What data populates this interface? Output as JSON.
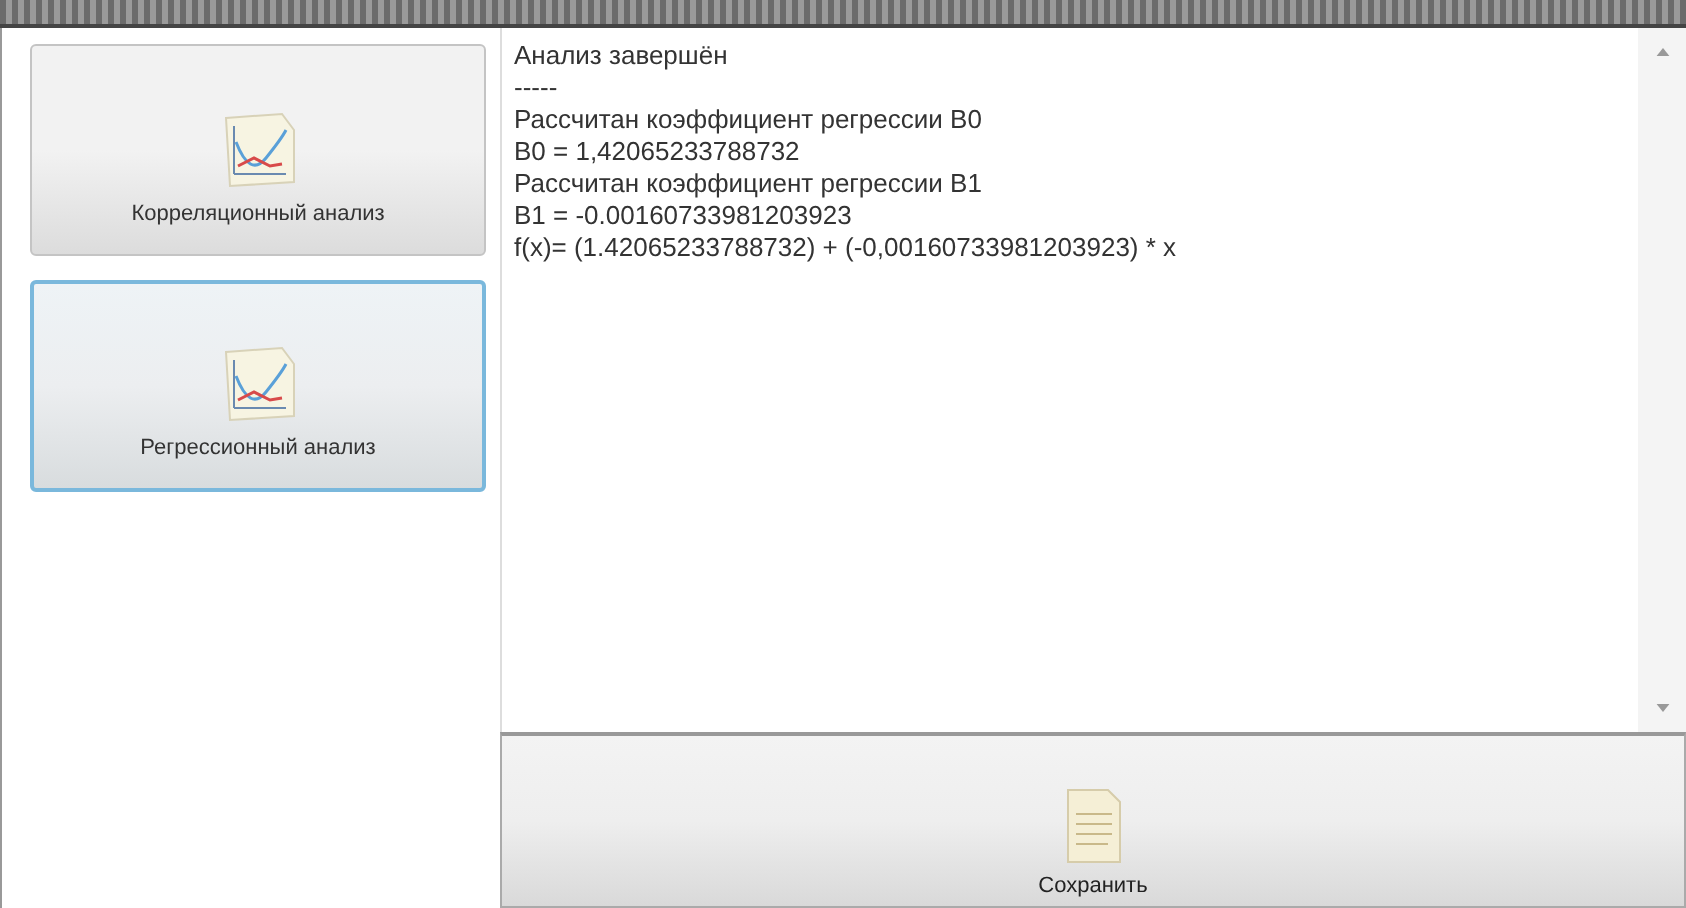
{
  "analysis_buttons": [
    {
      "label": "Корреляционный анализ",
      "selected": false
    },
    {
      "label": "Регрессионный анализ",
      "selected": true
    }
  ],
  "output": {
    "lines": [
      "Анализ завершён",
      "-----",
      "Рассчитан коэффициент регрессии B0",
      "B0 = 1,42065233788732",
      "Рассчитан коэффициент регрессии B1",
      "B1 = -0.00160733981203923",
      "f(x)= (1.42065233788732) + (-0,00160733981203923) * x"
    ]
  },
  "save_button": {
    "label": "Сохранить"
  }
}
